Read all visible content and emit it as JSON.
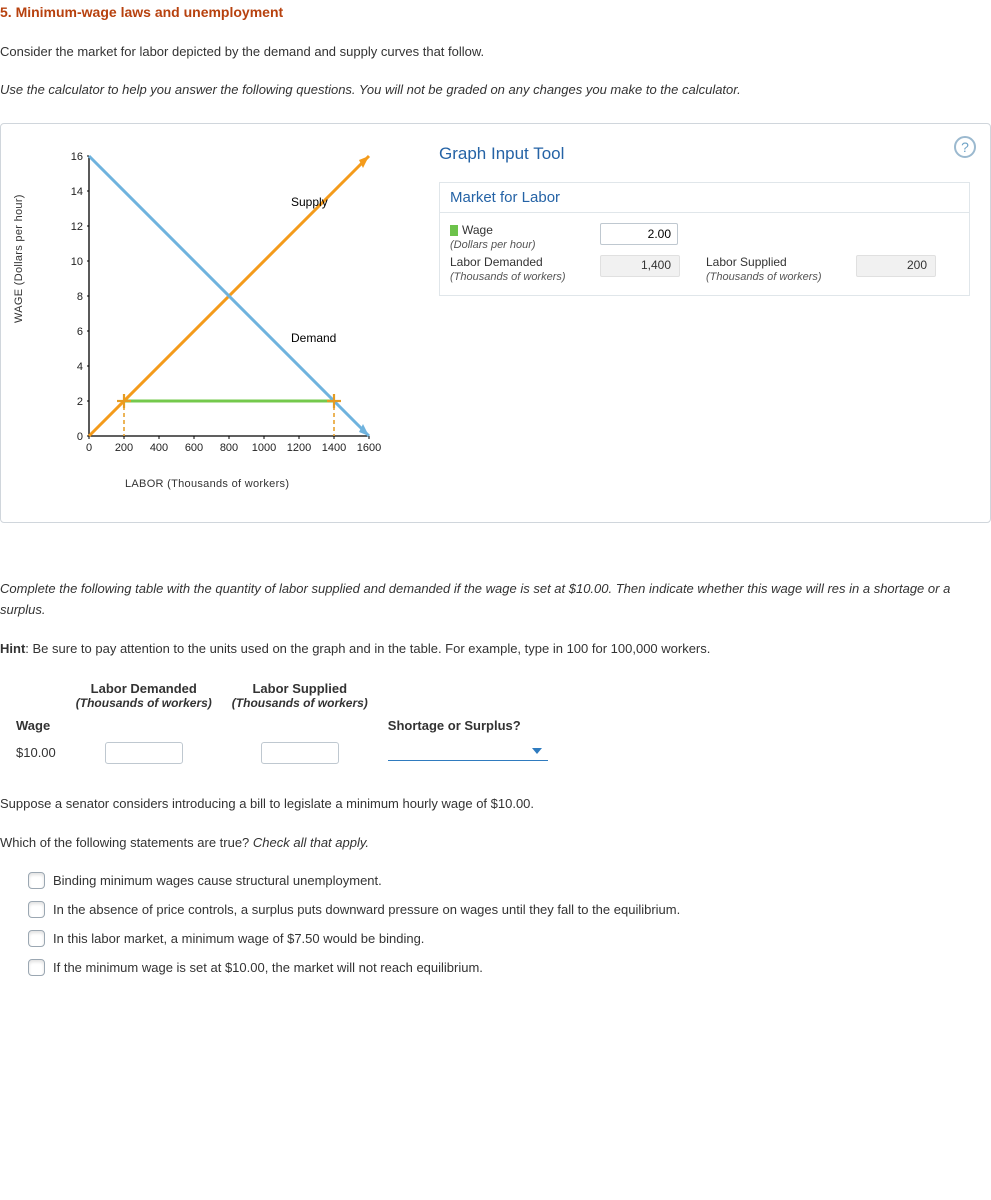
{
  "heading": "5. Minimum-wage laws and unemployment",
  "intro1": "Consider the market for labor depicted by the demand and supply curves that follow.",
  "intro2": "Use the calculator to help you answer the following questions. You will not be graded on any changes you make to the calculator.",
  "panel": {
    "title": "Graph Input Tool",
    "subtitle": "Market for Labor",
    "wage_label": "Wage",
    "wage_sub": "(Dollars per hour)",
    "wage_value": "2.00",
    "demand_label": "Labor Demanded",
    "demand_sub": "(Thousands of workers)",
    "demand_value": "1,400",
    "supply_label": "Labor Supplied",
    "supply_sub": "(Thousands of workers)",
    "supply_value": "200"
  },
  "chart_axis": {
    "y_label": "WAGE (Dollars per hour)",
    "x_label": "LABOR (Thousands of workers)",
    "supply_label": "Supply",
    "demand_label": "Demand"
  },
  "chart_data": {
    "type": "line",
    "xlabel": "LABOR (Thousands of workers)",
    "ylabel": "WAGE (Dollars per hour)",
    "xlim": [
      0,
      1600
    ],
    "ylim": [
      0,
      16
    ],
    "x_ticks": [
      0,
      200,
      400,
      600,
      800,
      1000,
      1200,
      1400,
      1600
    ],
    "y_ticks": [
      0,
      2,
      4,
      6,
      8,
      10,
      12,
      14,
      16
    ],
    "series": [
      {
        "name": "Supply",
        "color": "#f49b1b",
        "points": [
          [
            0,
            0
          ],
          [
            1600,
            16
          ]
        ]
      },
      {
        "name": "Demand",
        "color": "#6fb3de",
        "points": [
          [
            0,
            16
          ],
          [
            1600,
            0
          ]
        ]
      }
    ],
    "horizontal_marker": {
      "wage": 2,
      "x_from": 200,
      "x_to": 1400,
      "color": "#74c94c"
    },
    "cross_markers": [
      {
        "x": 200,
        "y": 2
      },
      {
        "x": 1400,
        "y": 2
      }
    ],
    "equilibrium": {
      "x": 800,
      "y": 8
    }
  },
  "q2": "Complete the following table with the quantity of labor supplied and demanded if the wage is set at $10.00. Then indicate whether this wage will res in a shortage or a surplus.",
  "hint_prefix": "Hint",
  "hint_body": ": Be sure to pay attention to the units used on the graph and in the table. For example, type in 100 for 100,000 workers.",
  "table": {
    "h_wage": "Wage",
    "h_demanded": "Labor Demanded",
    "h_demanded_sub": "(Thousands of workers)",
    "h_supplied": "Labor Supplied",
    "h_supplied_sub": "(Thousands of workers)",
    "h_ss": "Shortage or Surplus?",
    "row_wage": "$10.00"
  },
  "q3": "Suppose a senator considers introducing a bill to legislate a minimum hourly wage of $10.00.",
  "q4a": "Which of the following statements are true? ",
  "q4b": "Check all that apply.",
  "options": {
    "o1": "Binding minimum wages cause structural unemployment.",
    "o2": "In the absence of price controls, a surplus puts downward pressure on wages until they fall to the equilibrium.",
    "o3": "In this labor market, a minimum wage of $7.50 would be binding.",
    "o4": "If the minimum wage is set at $10.00, the market will not reach equilibrium."
  },
  "help_char": "?"
}
